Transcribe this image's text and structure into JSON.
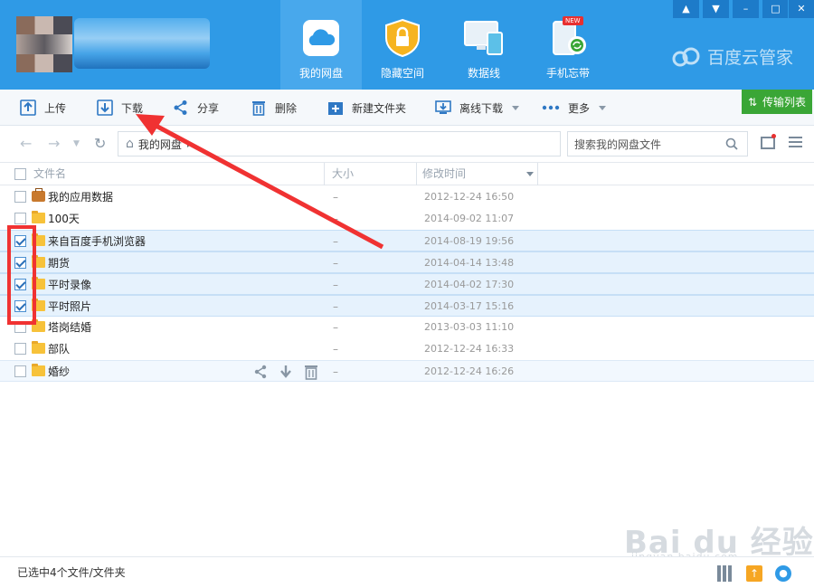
{
  "header": {
    "nav": [
      {
        "label": "我的网盘",
        "icon": "cloud-drive-icon",
        "active": true
      },
      {
        "label": "隐藏空间",
        "icon": "lock-shield-icon",
        "active": false
      },
      {
        "label": "数据线",
        "icon": "data-cable-devices-icon",
        "active": false
      },
      {
        "label": "手机忘带",
        "icon": "phone-sync-icon",
        "active": false,
        "badge": "NEW"
      }
    ],
    "brand": "百度云管家",
    "window_controls": [
      "notification-bell-icon",
      "menu-dropdown-icon",
      "minimize-icon",
      "maximize-icon",
      "close-icon"
    ]
  },
  "toolbar": {
    "upload": "上传",
    "download": "下载",
    "share": "分享",
    "delete": "删除",
    "new_folder": "新建文件夹",
    "offline_download": "离线下载",
    "more": "更多",
    "transfer_list": "传输列表"
  },
  "address": {
    "path": "我的网盘",
    "search_placeholder": "搜索我的网盘文件"
  },
  "table": {
    "columns": [
      "文件名",
      "大小",
      "修改时间"
    ],
    "rows": [
      {
        "name": "我的应用数据",
        "size": "–",
        "date": "2012-12-24 16:50",
        "checked": false,
        "type": "app"
      },
      {
        "name": "100天",
        "size": "–",
        "date": "2014-09-02 11:07",
        "checked": false,
        "type": "folder"
      },
      {
        "name": "来自百度手机浏览器",
        "size": "–",
        "date": "2014-08-19 19:56",
        "checked": true,
        "type": "folder"
      },
      {
        "name": "期货",
        "size": "–",
        "date": "2014-04-14 13:48",
        "checked": true,
        "type": "folder"
      },
      {
        "name": "平时录像",
        "size": "–",
        "date": "2014-04-02 17:30",
        "checked": true,
        "type": "folder"
      },
      {
        "name": "平时照片",
        "size": "–",
        "date": "2014-03-17 15:16",
        "checked": true,
        "type": "folder"
      },
      {
        "name": "塔岗结婚",
        "size": "–",
        "date": "2013-03-03 11:10",
        "checked": false,
        "type": "folder"
      },
      {
        "name": "部队",
        "size": "–",
        "date": "2012-12-24 16:33",
        "checked": false,
        "type": "folder"
      },
      {
        "name": "婚纱",
        "size": "–",
        "date": "2012-12-24 16:26",
        "checked": false,
        "type": "folder"
      }
    ]
  },
  "status": {
    "selection": "已选中4个文件/文件夹"
  },
  "watermark": {
    "main": "Bai du 经验",
    "sub": "jingyan.baidu.com"
  },
  "colors": {
    "header_bg": "#2f9ae6",
    "active_nav": "#48a8ec",
    "transfer_green": "#3aa636",
    "highlight_red": "#f03232"
  }
}
